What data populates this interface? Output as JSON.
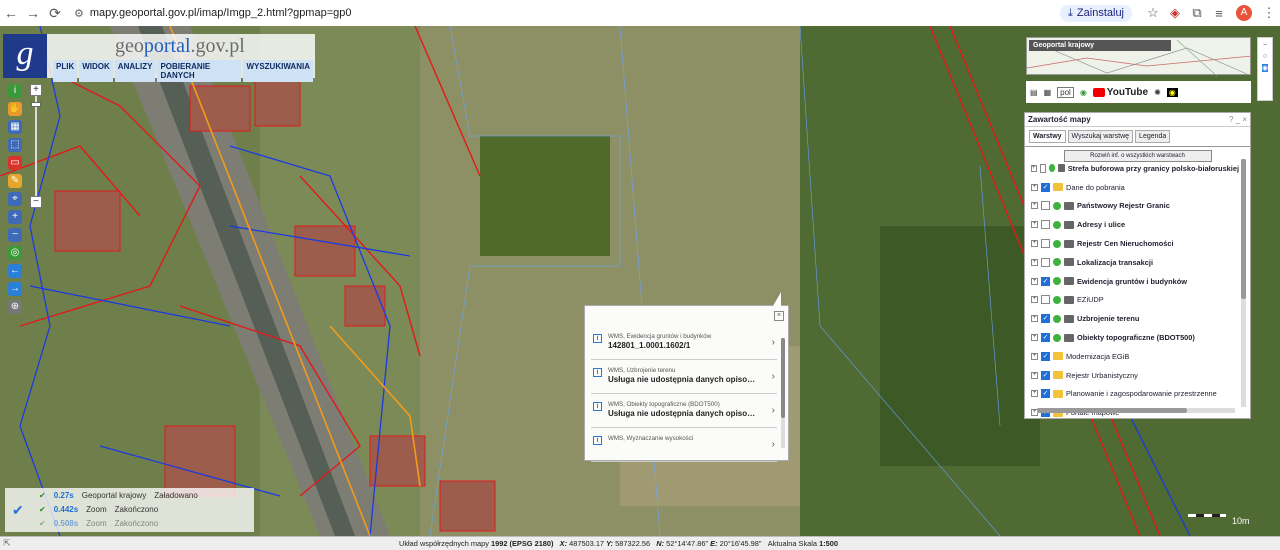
{
  "browser": {
    "url": "mapy.geoportal.gov.pl/imap/Imgp_2.html?gpmap=gp0",
    "install_label": "Zainstaluj",
    "profile_initial": "A"
  },
  "app": {
    "logo_letter": "g",
    "name_prefix": "geo",
    "name_mid": "portal",
    "name_suffix": ".gov.pl",
    "menu": [
      "PLIK",
      "WIDOK",
      "ANALIZY",
      "POBIERANIE DANYCH",
      "WYSZUKIWANIA"
    ]
  },
  "minimap": {
    "title": "Geoportal krajowy"
  },
  "toolbar": {
    "language": "pol",
    "youtube_label": "YouTube"
  },
  "panel": {
    "title": "Zawartość mapy",
    "controls": "? _ ×",
    "tabs": [
      "Warstwy",
      "Wyszukaj warstwę",
      "Legenda"
    ],
    "expand_button": "Rozwiń inf. o wszystkich warstwach",
    "layers": [
      {
        "name": "Strefa buforowa przy granicy polsko-białoruskiej",
        "checked": false,
        "bold": true,
        "kind": "wms"
      },
      {
        "name": "Dane do pobrania",
        "checked": true,
        "bold": false,
        "kind": "folder"
      },
      {
        "name": "Państwowy Rejestr Granic",
        "checked": false,
        "bold": true,
        "kind": "wms"
      },
      {
        "name": "Adresy i ulice",
        "checked": false,
        "bold": true,
        "kind": "wms"
      },
      {
        "name": "Rejestr Cen Nieruchomości",
        "checked": false,
        "bold": true,
        "kind": "wms"
      },
      {
        "name": "Lokalizacja transakcji",
        "checked": false,
        "bold": true,
        "kind": "wms"
      },
      {
        "name": "Ewidencja gruntów i budynków",
        "checked": true,
        "bold": true,
        "kind": "wms"
      },
      {
        "name": "EZiUDP",
        "checked": false,
        "bold": false,
        "kind": "wms"
      },
      {
        "name": "Uzbrojenie terenu",
        "checked": true,
        "bold": true,
        "kind": "wms"
      },
      {
        "name": "Obiekty topograficzne (BDOT500)",
        "checked": true,
        "bold": true,
        "kind": "wms"
      },
      {
        "name": "Modernizacja EGiB",
        "checked": true,
        "bold": false,
        "kind": "folder"
      },
      {
        "name": "Rejestr Urbanistyczny",
        "checked": true,
        "bold": false,
        "kind": "folder"
      },
      {
        "name": "Planowanie i zagospodarowanie przestrzenne",
        "checked": true,
        "bold": false,
        "kind": "folder"
      },
      {
        "name": "Portale mapowe",
        "checked": true,
        "bold": false,
        "kind": "folder"
      }
    ]
  },
  "popup": {
    "items": [
      {
        "source": "WMS, Ewidencja gruntów i budynków",
        "value": "142801_1.0001.1602/1"
      },
      {
        "source": "WMS, Uzbrojenie terenu",
        "value": "Usługa nie udostępnia danych opisowych"
      },
      {
        "source": "WMS, Obiekty topograficzne (BDOT500)",
        "value": "Usługa nie udostępnia danych opisowych"
      },
      {
        "source": "WMS, Wyznaczanie wysokości",
        "value": ""
      }
    ]
  },
  "status": {
    "rows": [
      {
        "time": "0.27s",
        "service": "Geoportal krajowy",
        "state": "Załadowano"
      },
      {
        "time": "0.442s",
        "service": "Zoom",
        "state": "Zakończono"
      },
      {
        "time": "0.508s",
        "service": "Zoom",
        "state": "Zakończono"
      }
    ]
  },
  "scale_bar": {
    "label": "10m"
  },
  "coordinates": {
    "system_label": "Układ współrzędnych mapy",
    "system_value": "1992 (EPSG 2180)",
    "x_label": "X:",
    "x_value": "487503.17",
    "y_label": "Y:",
    "y_value": "587322.56",
    "n_label": "N:",
    "n_value": "52°14'47.86\"",
    "e_label": "E:",
    "e_value": "20°16'45.98\"",
    "scale_label": "Aktualna Skala",
    "scale_value": "1:500"
  },
  "colors": {
    "accent": "#1f6fd6",
    "parcel_line": "#e21a1a",
    "utility_line": "#1b3be0",
    "topo_line": "#f39a1b",
    "logo_bg": "#1f3a8a"
  }
}
